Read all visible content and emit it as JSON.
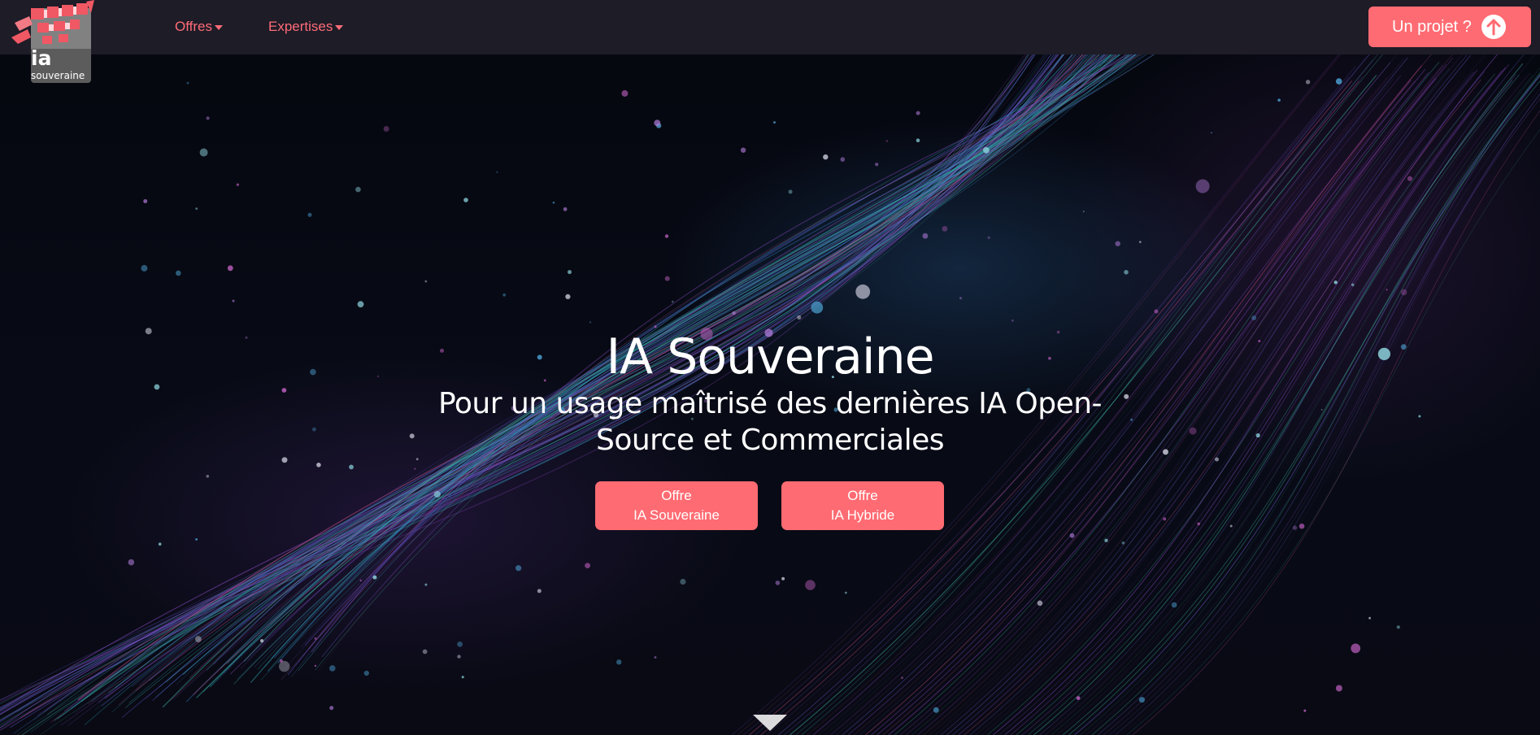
{
  "brand": {
    "logo_line1": "ia",
    "logo_line2": "souveraine",
    "accent_color": "#ff6b72"
  },
  "nav": {
    "items": [
      {
        "label": "Offres",
        "icon": "caret-down-icon"
      },
      {
        "label": "Expertises",
        "icon": "caret-down-icon"
      }
    ],
    "cta_label": "Un projet ?",
    "cta_icon": "arrow-up-circle-icon"
  },
  "hero": {
    "title": "IA Souveraine",
    "subtitle": "Pour un usage maîtrisé des dernières IA Open-Source et Commerciales",
    "buttons": [
      {
        "line1": "Offre",
        "line2": "IA Souveraine"
      },
      {
        "line1": "Offre",
        "line2": "IA Hybride"
      }
    ],
    "scroll_icon": "triangle-down-icon"
  }
}
